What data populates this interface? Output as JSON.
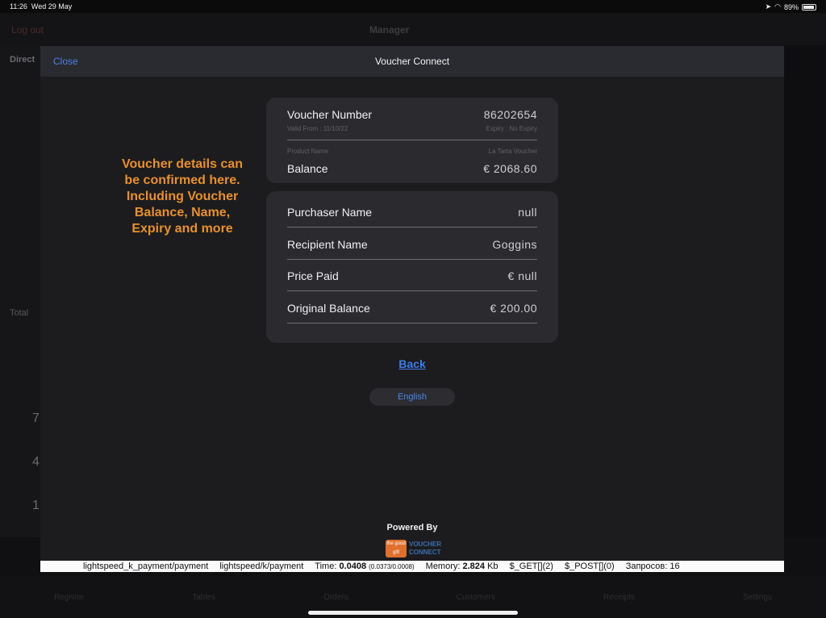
{
  "status_bar": {
    "time": "11:26",
    "date": "Wed 29 May",
    "battery": "89%"
  },
  "background": {
    "logout": "Log out",
    "manager": "Manager",
    "left_label": "Direct",
    "total_label": "Total",
    "keypad_digits": [
      "7",
      "4",
      "1"
    ],
    "tabs": [
      "Register",
      "Tables",
      "Orders",
      "Customers",
      "Receipts",
      "Settings"
    ]
  },
  "modal": {
    "close_label": "Close",
    "title": "Voucher Connect"
  },
  "annotation": "Voucher details can be confirmed here. Including Voucher Balance, Name, Expiry and more",
  "voucher": {
    "number_label": "Voucher Number",
    "number_value": "86202654",
    "valid_from": "Valid From : 11/10/22",
    "expiry": "Expiry : No Expiry",
    "product_name_label": "Product Name",
    "product_name_value": "La Tarta Voucher",
    "balance_label": "Balance",
    "balance_value": "€ 2068.60"
  },
  "details": {
    "purchaser_label": "Purchaser Name",
    "purchaser_value": "null",
    "recipient_label": "Recipient Name",
    "recipient_value": "Goggins",
    "price_label": "Price Paid",
    "price_value": "€ null",
    "original_label": "Original Balance",
    "original_value": "€ 200.00"
  },
  "back_label": "Back",
  "language": "English",
  "powered_by": "Powered By",
  "logo": {
    "badge": "the good gift",
    "line1": "VOUCHER",
    "line2": "CONNECT"
  },
  "debug": {
    "route1": "lightspeed_k_payment/payment",
    "route2": "lightspeed/k/payment",
    "time_label": "Time:",
    "time_value": "0.0408",
    "time_detail": "(0.0373/0.0008)",
    "memory_label": "Memory:",
    "memory_value": "2.824",
    "memory_unit": "Kb",
    "get": "$_GET[](2)",
    "post": "$_POST[](0)",
    "requests": "Запросов: 16"
  }
}
